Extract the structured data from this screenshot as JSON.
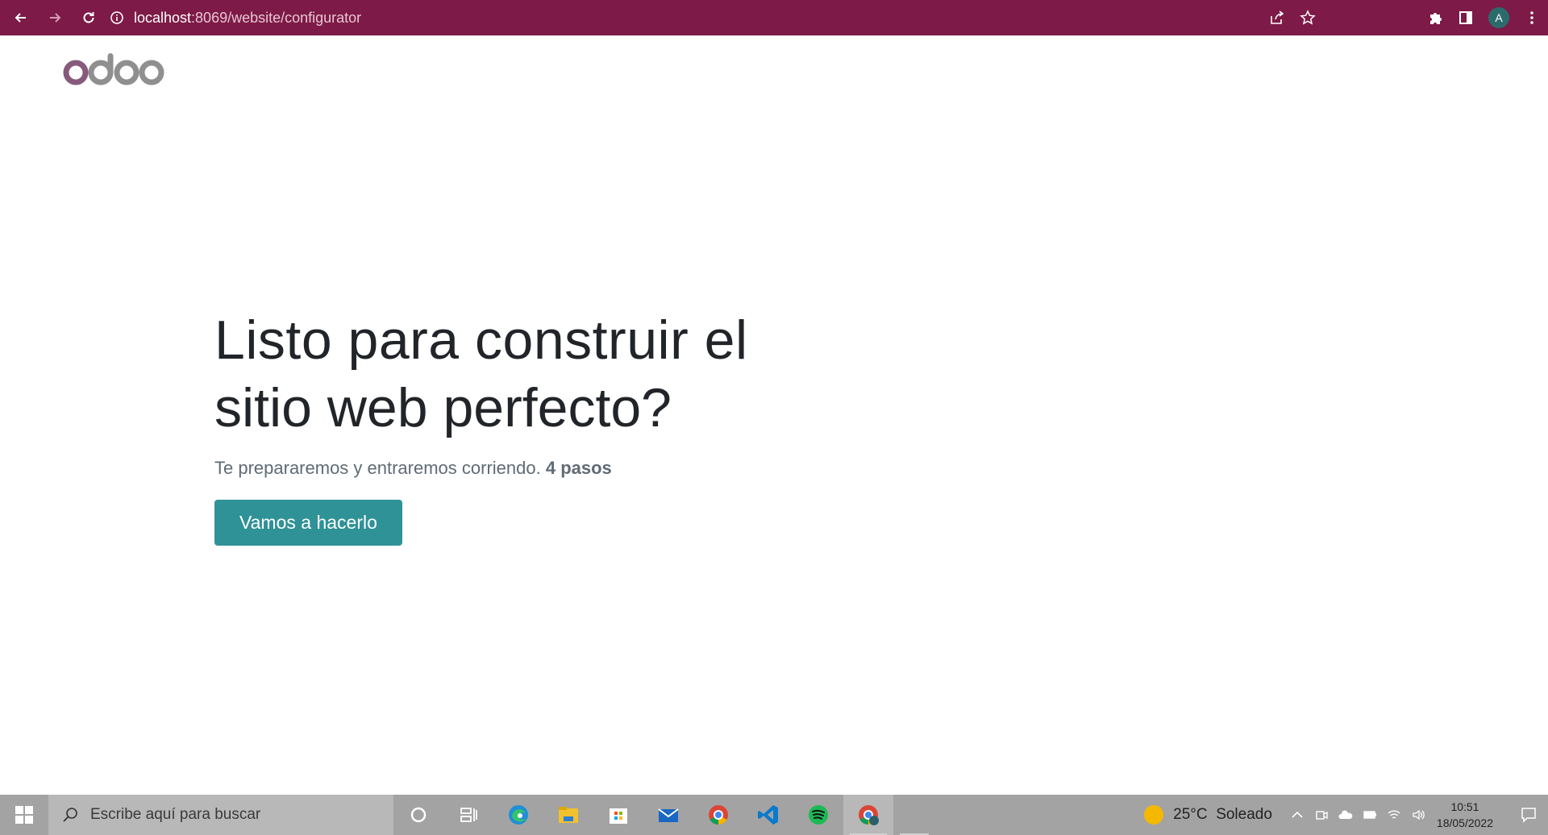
{
  "browser": {
    "url_host": "localhost",
    "url_path": ":8069/website/configurator",
    "profile_initial": "A",
    "theme_color": "#7d1a47"
  },
  "page": {
    "logo_text": "odoo",
    "title_line1": "Listo para construir el",
    "title_line2": "sitio web perfecto?",
    "subtitle": "Te prepararemos y entraremos corriendo.",
    "subtitle_bold": "4 pasos",
    "cta_label": "Vamos a hacerlo",
    "cta_color": "#2f9297"
  },
  "taskbar": {
    "search_placeholder": "Escribe aquí para buscar",
    "apps": [
      "task-view",
      "edge",
      "file-explorer",
      "microsoft-store",
      "mail",
      "chrome",
      "vscode",
      "spotify",
      "chrome-profile"
    ],
    "weather_temp": "25°C",
    "weather_desc": "Soleado",
    "time": "10:51",
    "date": "18/05/2022"
  }
}
